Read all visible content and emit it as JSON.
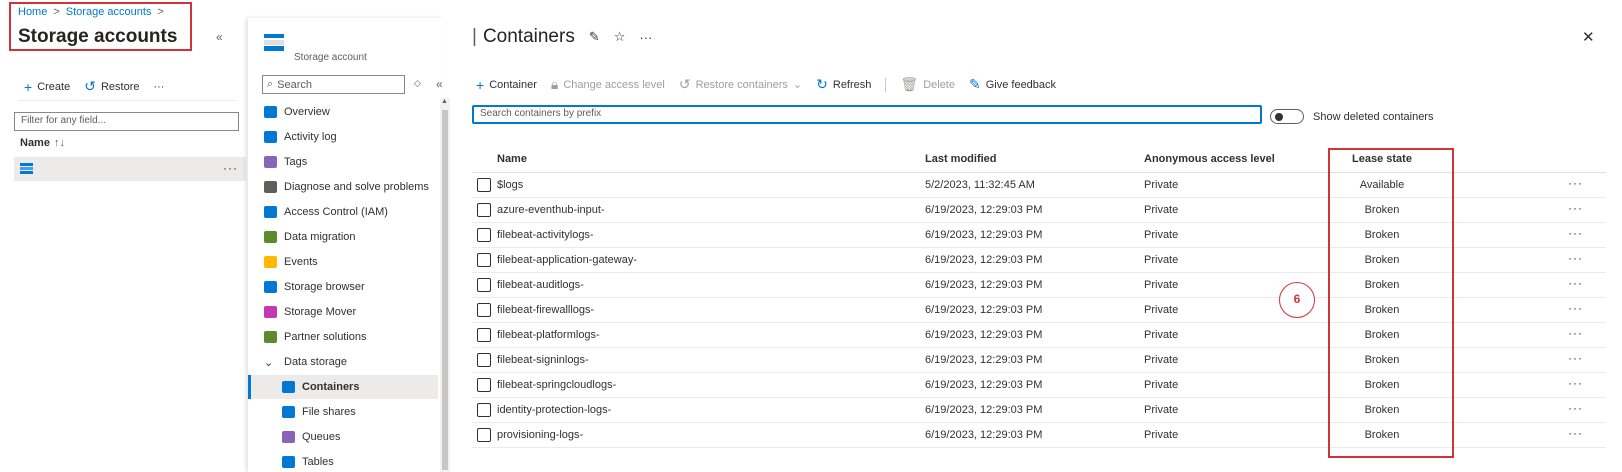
{
  "breadcrumb": [
    "Home",
    "Storage accounts"
  ],
  "left_pane": {
    "title": "Storage accounts",
    "toolbar": {
      "create": "Create",
      "restore": "Restore"
    },
    "filter_placeholder": "Filter for any field...",
    "name_header": "Name",
    "sort_glyph": "↑↓"
  },
  "nav": {
    "resource_type": "Storage account",
    "search_placeholder": "Search",
    "items": [
      {
        "label": "Overview",
        "icon": "overview-icon",
        "color": "#0078d4"
      },
      {
        "label": "Activity log",
        "icon": "activity-log-icon",
        "color": "#0078d4"
      },
      {
        "label": "Tags",
        "icon": "tag-icon",
        "color": "#8764b8"
      },
      {
        "label": "Diagnose and solve problems",
        "icon": "wrench-icon",
        "color": "#605e5c"
      },
      {
        "label": "Access Control (IAM)",
        "icon": "iam-icon",
        "color": "#0078d4"
      },
      {
        "label": "Data migration",
        "icon": "data-migration-icon",
        "color": "#5c8a2d"
      },
      {
        "label": "Events",
        "icon": "lightning-icon",
        "color": "#ffb900"
      },
      {
        "label": "Storage browser",
        "icon": "folder-icon",
        "color": "#0078d4"
      },
      {
        "label": "Storage Mover",
        "icon": "storage-mover-icon",
        "color": "#c239b3"
      },
      {
        "label": "Partner solutions",
        "icon": "partner-icon",
        "color": "#5c8a2d"
      }
    ],
    "group": {
      "label": "Data storage"
    },
    "sub_items": [
      {
        "label": "Containers",
        "icon": "containers-icon",
        "color": "#0078d4"
      },
      {
        "label": "File shares",
        "icon": "file-shares-icon",
        "color": "#0078d4"
      },
      {
        "label": "Queues",
        "icon": "queues-icon",
        "color": "#8764b8"
      },
      {
        "label": "Tables",
        "icon": "tables-icon",
        "color": "#0078d4"
      }
    ]
  },
  "main": {
    "title": "Containers",
    "toolbar": {
      "container": "Container",
      "change_access": "Change access level",
      "restore_containers": "Restore containers",
      "refresh": "Refresh",
      "delete": "Delete",
      "feedback": "Give feedback"
    },
    "search_placeholder": "Search containers by prefix",
    "show_deleted": "Show deleted containers",
    "columns": [
      "Name",
      "Last modified",
      "Anonymous access level",
      "Lease state"
    ],
    "rows": [
      {
        "name": "$logs",
        "modified": "5/2/2023, 11:32:45 AM",
        "access": "Private",
        "lease": "Available"
      },
      {
        "name": "azure-eventhub-input-",
        "modified": "6/19/2023, 12:29:03 PM",
        "access": "Private",
        "lease": "Broken"
      },
      {
        "name": "filebeat-activitylogs-",
        "modified": "6/19/2023, 12:29:03 PM",
        "access": "Private",
        "lease": "Broken"
      },
      {
        "name": "filebeat-application-gateway-",
        "modified": "6/19/2023, 12:29:03 PM",
        "access": "Private",
        "lease": "Broken"
      },
      {
        "name": "filebeat-auditlogs-",
        "modified": "6/19/2023, 12:29:03 PM",
        "access": "Private",
        "lease": "Broken"
      },
      {
        "name": "filebeat-firewalllogs-",
        "modified": "6/19/2023, 12:29:03 PM",
        "access": "Private",
        "lease": "Broken"
      },
      {
        "name": "filebeat-platformlogs-",
        "modified": "6/19/2023, 12:29:03 PM",
        "access": "Private",
        "lease": "Broken"
      },
      {
        "name": "filebeat-signinlogs-",
        "modified": "6/19/2023, 12:29:03 PM",
        "access": "Private",
        "lease": "Broken"
      },
      {
        "name": "filebeat-springcloudlogs-",
        "modified": "6/19/2023, 12:29:03 PM",
        "access": "Private",
        "lease": "Broken"
      },
      {
        "name": "identity-protection-logs-",
        "modified": "6/19/2023, 12:29:03 PM",
        "access": "Private",
        "lease": "Broken"
      },
      {
        "name": "provisioning-logs-",
        "modified": "6/19/2023, 12:29:03 PM",
        "access": "Private",
        "lease": "Broken"
      }
    ]
  },
  "callout": "6",
  "colors": {
    "accent": "#0078d4",
    "highlight": "#d13438"
  }
}
